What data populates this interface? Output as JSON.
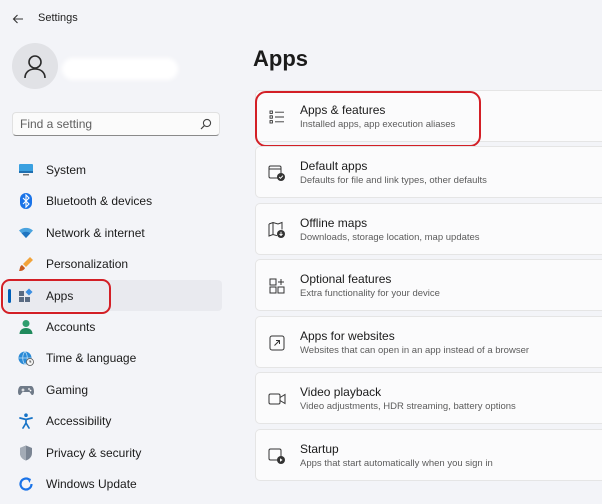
{
  "window": {
    "title": "Settings"
  },
  "search": {
    "placeholder": "Find a setting"
  },
  "sidebar": {
    "items": [
      {
        "label": "System",
        "icon": "monitor-icon"
      },
      {
        "label": "Bluetooth & devices",
        "icon": "bluetooth-icon"
      },
      {
        "label": "Network & internet",
        "icon": "wifi-icon"
      },
      {
        "label": "Personalization",
        "icon": "brush-icon"
      },
      {
        "label": "Apps",
        "icon": "apps-icon",
        "active": true
      },
      {
        "label": "Accounts",
        "icon": "person-icon"
      },
      {
        "label": "Time & language",
        "icon": "globe-clock-icon"
      },
      {
        "label": "Gaming",
        "icon": "gamepad-icon"
      },
      {
        "label": "Accessibility",
        "icon": "accessibility-icon"
      },
      {
        "label": "Privacy & security",
        "icon": "shield-icon"
      },
      {
        "label": "Windows Update",
        "icon": "update-icon"
      }
    ]
  },
  "main": {
    "title": "Apps",
    "cards": [
      {
        "title": "Apps & features",
        "subtitle": "Installed apps, app execution aliases",
        "icon": "list-icon"
      },
      {
        "title": "Default apps",
        "subtitle": "Defaults for file and link types, other defaults",
        "icon": "default-apps-icon"
      },
      {
        "title": "Offline maps",
        "subtitle": "Downloads, storage location, map updates",
        "icon": "map-icon"
      },
      {
        "title": "Optional features",
        "subtitle": "Extra functionality for your device",
        "icon": "add-grid-icon"
      },
      {
        "title": "Apps for websites",
        "subtitle": "Websites that can open in an app instead of a browser",
        "icon": "open-link-icon"
      },
      {
        "title": "Video playback",
        "subtitle": "Video adjustments, HDR streaming, battery options",
        "icon": "video-icon"
      },
      {
        "title": "Startup",
        "subtitle": "Apps that start automatically when you sign in",
        "icon": "startup-icon"
      }
    ]
  },
  "colors": {
    "accent": "#005fb8",
    "highlight": "#d31f26"
  }
}
